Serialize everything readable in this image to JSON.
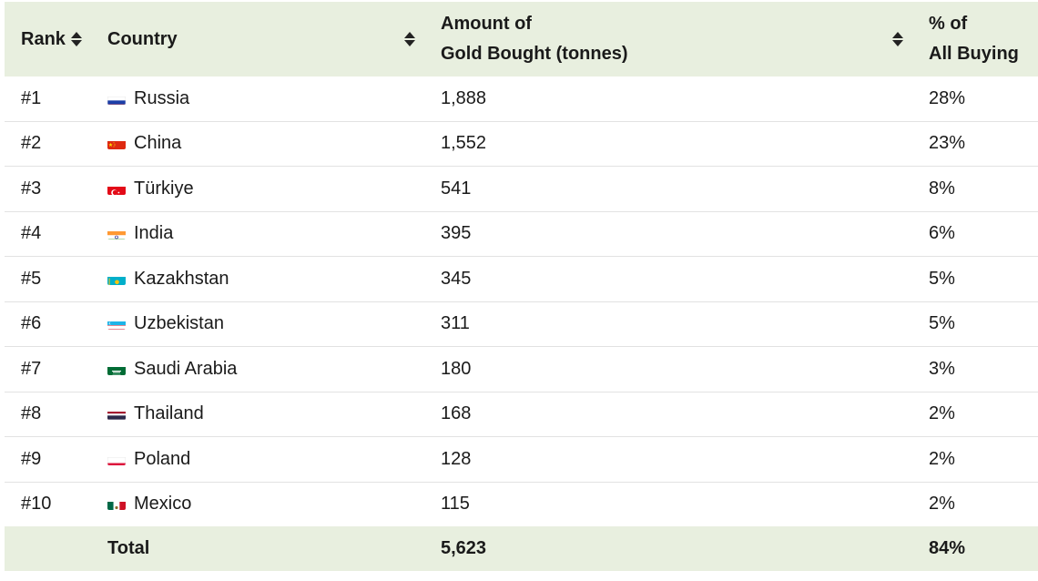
{
  "header": {
    "rank": "Rank",
    "country": "Country",
    "amount_line1": "Amount of",
    "amount_line2": "Gold Bought (tonnes)",
    "pct_line1": "% of",
    "pct_line2": "All Buying"
  },
  "rows": [
    {
      "rank": "#1",
      "country": "Russia",
      "flag": "russia-flag-icon",
      "amount": "1,888",
      "pct": "28%"
    },
    {
      "rank": "#2",
      "country": "China",
      "flag": "china-flag-icon",
      "amount": "1,552",
      "pct": "23%"
    },
    {
      "rank": "#3",
      "country": "Türkiye",
      "flag": "turkiye-flag-icon",
      "amount": "541",
      "pct": "8%"
    },
    {
      "rank": "#4",
      "country": "India",
      "flag": "india-flag-icon",
      "amount": "395",
      "pct": "6%"
    },
    {
      "rank": "#5",
      "country": "Kazakhstan",
      "flag": "kazakhstan-flag-icon",
      "amount": "345",
      "pct": "5%"
    },
    {
      "rank": "#6",
      "country": "Uzbekistan",
      "flag": "uzbekistan-flag-icon",
      "amount": "311",
      "pct": "5%"
    },
    {
      "rank": "#7",
      "country": "Saudi Arabia",
      "flag": "saudi-arabia-flag-icon",
      "amount": "180",
      "pct": "3%"
    },
    {
      "rank": "#8",
      "country": "Thailand",
      "flag": "thailand-flag-icon",
      "amount": "168",
      "pct": "2%"
    },
    {
      "rank": "#9",
      "country": "Poland",
      "flag": "poland-flag-icon",
      "amount": "128",
      "pct": "2%"
    },
    {
      "rank": "#10",
      "country": "Mexico",
      "flag": "mexico-flag-icon",
      "amount": "115",
      "pct": "2%"
    }
  ],
  "footer": {
    "label": "Total",
    "amount": "5,623",
    "pct": "84%"
  },
  "colors": {
    "header_bg": "#e8efdf",
    "row_divider": "#e2e2e2"
  }
}
